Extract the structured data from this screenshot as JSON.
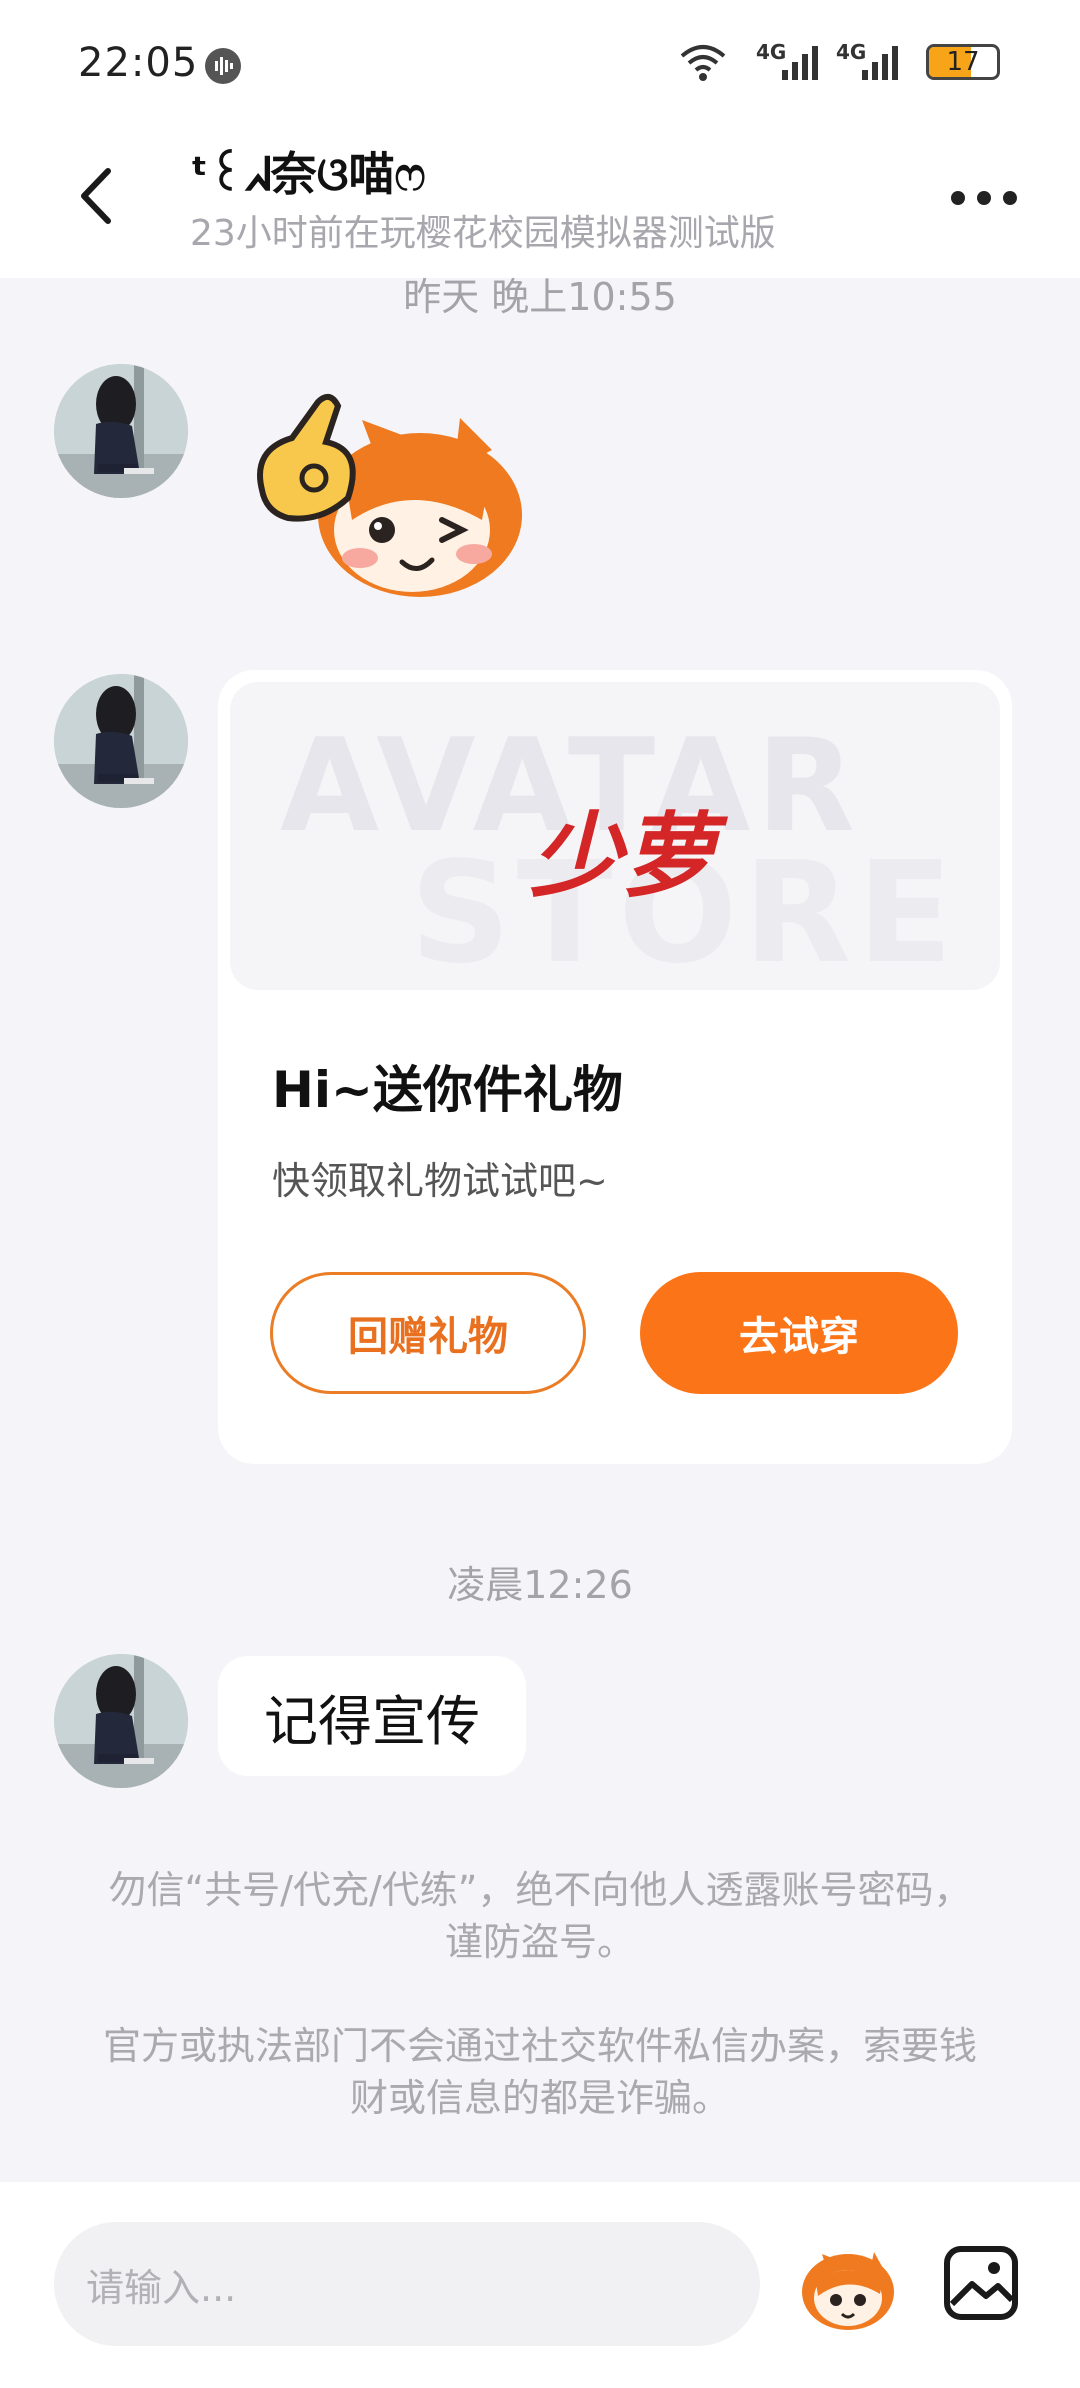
{
  "status_bar": {
    "time": "22:05",
    "network_1": "4G",
    "network_2": "4G",
    "battery": "17",
    "icons": [
      "voice-recorder-icon",
      "wifi-icon",
      "signal-icon",
      "signal-icon",
      "battery-icon"
    ]
  },
  "header": {
    "name": "ᵗ꒰ᖽ奈ଓ喵ෆ",
    "status": "23小时前在玩樱花校园模拟器测试版",
    "back_icon": "chevron-left-icon",
    "more_icon": "more-dots-icon"
  },
  "messages": {
    "timestamp_1": "昨天 晚上10:55",
    "timestamp_2": "凌晨12:26",
    "gift_card": {
      "banner_bg_1": "AVATAR",
      "banner_bg_2": "STORE",
      "banner_logo": "少萝",
      "title": "Hi~送你件礼物",
      "subtitle": "快领取礼物试试吧~",
      "return_label": "回赠礼物",
      "try_label": "去试穿"
    },
    "text_message": "记得宣传"
  },
  "notices": {
    "line_1": "勿信“共号/代充/代练”，绝不向他人透露账号密码，谨防盗号。",
    "line_2": "官方或执法部门不会通过社交软件私信办案，索要钱财或信息的都是诈骗。"
  },
  "input": {
    "placeholder": "请输入..."
  },
  "colors": {
    "accent": "#fb7418",
    "background": "#f4f4f9",
    "logo_red": "#d42626"
  }
}
